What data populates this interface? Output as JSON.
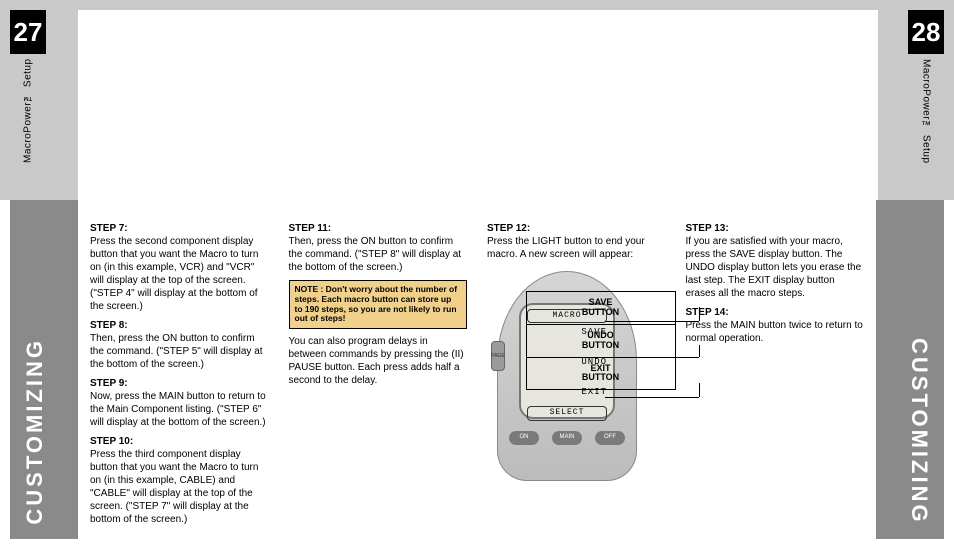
{
  "pageLeft": "27",
  "pageRight": "28",
  "spineTop": "MacroPower™ Setup",
  "sectionLabel": "CUSTOMIZING",
  "col1": {
    "s7h": "STEP 7:",
    "s7": "Press the second component display button that you want the Macro to turn on (in this example, VCR) and \"VCR\" will display at the top of the screen. (\"STEP 4\" will display at the bottom of the screen.)",
    "s8h": "STEP 8:",
    "s8": "Then, press the ON button to confirm the command. (\"STEP 5\" will display at the bottom of the screen.)",
    "s9h": "STEP 9:",
    "s9": "Now, press the MAIN button to return to the Main Component listing. (\"STEP 6\" will display at the bottom of the screen.)",
    "s10h": "STEP 10:",
    "s10": "Press the third component display button that you want the Macro to turn on (in this example, CABLE) and \"CABLE\" will display at the top of the screen. (\"STEP 7\" will display at the bottom of the screen.)"
  },
  "col2": {
    "s11h": "STEP 11:",
    "s11": "Then, press the ON button to confirm the command. (\"STEP 8\" will display at the bottom of the screen.)",
    "note": "NOTE : Don't worry about the number of steps. Each macro button can store up to 190 steps, so you are not likely to run out of steps!",
    "s11b": "You can also program delays in between commands by pressing the (II) PAUSE button. Each press adds half a second to the delay."
  },
  "col3": {
    "s12h": "STEP 12:",
    "s12": "Press the LIGHT button to end your macro. A new screen will appear:",
    "screenTitle": "MACRO",
    "r1": "SAVE",
    "r2": "UNDO",
    "r3": "EXIT",
    "screenBottom": "SELECT",
    "bOn": "ON",
    "bMain": "MAIN",
    "bOff": "OFF",
    "bPage": "PAGE",
    "lab1a": "SAVE",
    "lab1b": "BUTTON",
    "lab2a": "UNDO",
    "lab2b": "BUTTON",
    "lab3a": "EXIT",
    "lab3b": "BUTTON"
  },
  "col4": {
    "s13h": "STEP 13:",
    "s13": "If you are satisfied with your macro, press the SAVE display button. The UNDO display button lets you erase the last step. The EXIT display button erases all the macro steps.",
    "s14h": "STEP 14:",
    "s14": "Press the MAIN button twice to return to normal operation."
  }
}
